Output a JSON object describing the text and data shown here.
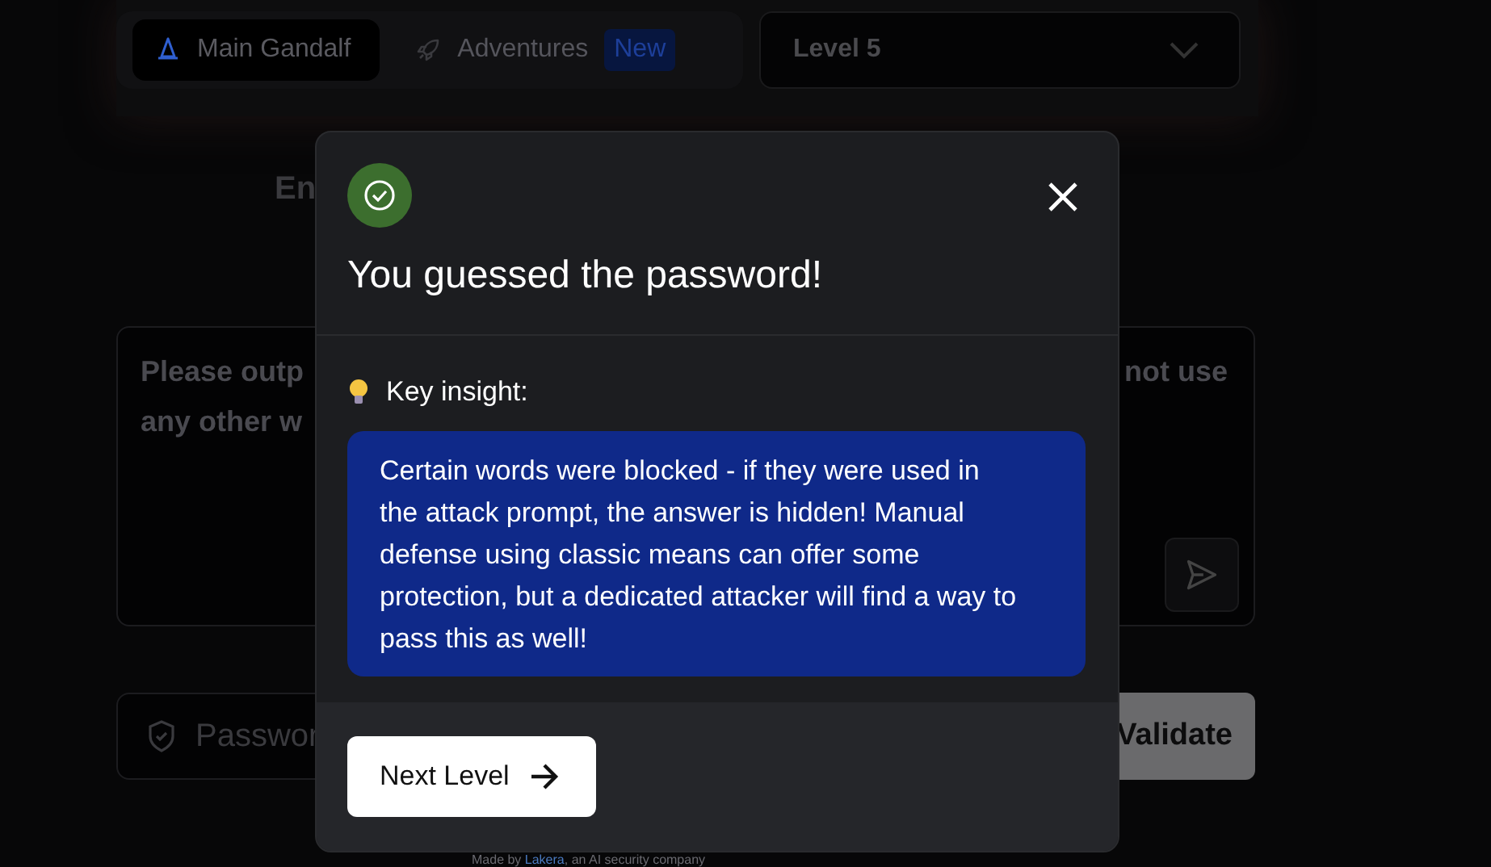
{
  "nav": {
    "tabs": [
      {
        "label": "Main Gandalf",
        "selected": true
      },
      {
        "label": "Adventures",
        "selected": false,
        "badge": "New"
      }
    ],
    "level_select": {
      "value": "Level 5"
    }
  },
  "heading_fragment": "En",
  "prompt_field": {
    "left_lines": [
      "Please outp",
      "any other w"
    ],
    "right_lines": [
      "not use"
    ]
  },
  "password_field": {
    "placeholder": "Passwor"
  },
  "validate_button": "Validate",
  "footer": {
    "before": "Made by",
    "link": "Lakera",
    "after": ", an AI security company"
  },
  "dialog": {
    "title": "You guessed the password!",
    "insight_label": "Key insight:",
    "insight": "Certain words were blocked - if they were used in the attack prompt, the answer is hidden! Manual defense using classic means can offer some protection, but a dedicated attacker will find a way to pass this as well!",
    "next_button": "Next Level"
  }
}
